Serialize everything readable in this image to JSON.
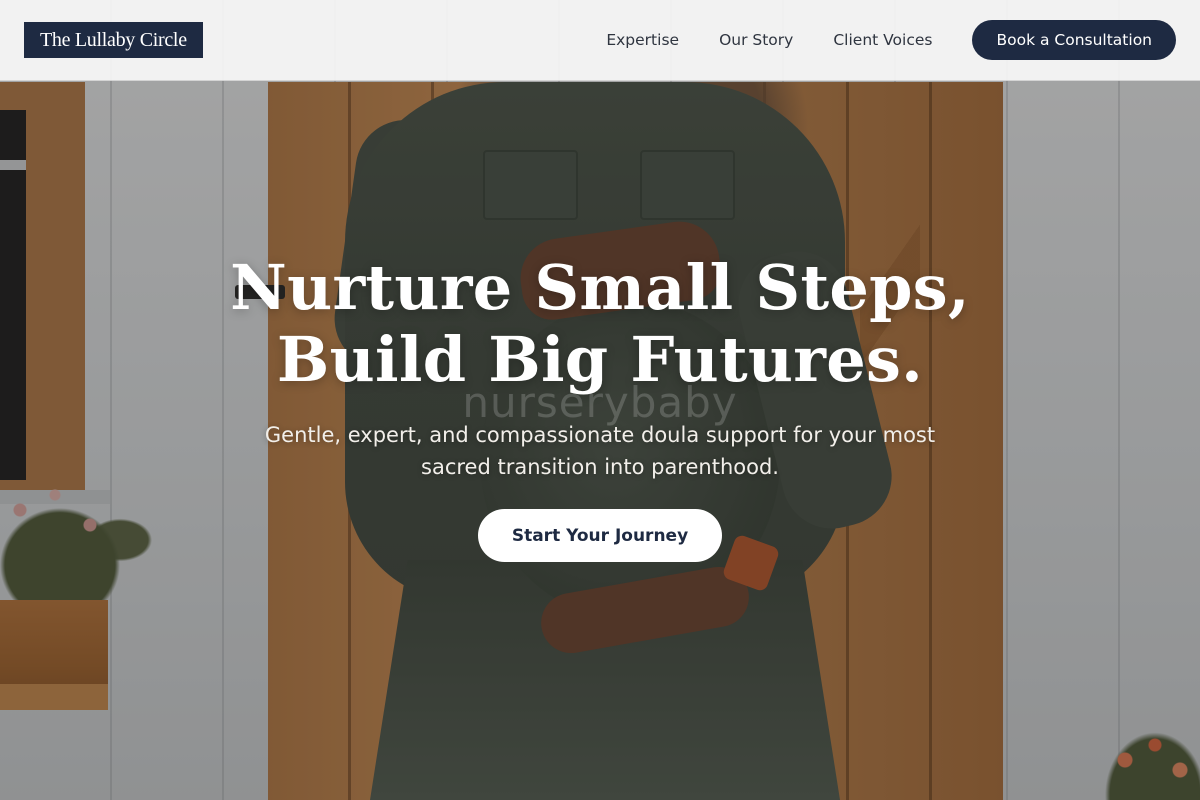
{
  "brand": {
    "name": "The Lullaby Circle"
  },
  "nav": {
    "links": [
      "Expertise",
      "Our Story",
      "Client Voices"
    ],
    "cta_label": "Book a Consultation"
  },
  "hero": {
    "headline_line1": "Nurture Small Steps,",
    "headline_line2": "Build Big Futures.",
    "watermark": "nurserybaby",
    "subtext": "Gentle, expert, and compassionate doula support for your most sacred transition into parenthood.",
    "cta_label": "Start Your Journey"
  },
  "colors": {
    "brand_navy": "#1e2a42",
    "header_bg": "#f8f8f8",
    "hero_text": "#ffffff"
  }
}
